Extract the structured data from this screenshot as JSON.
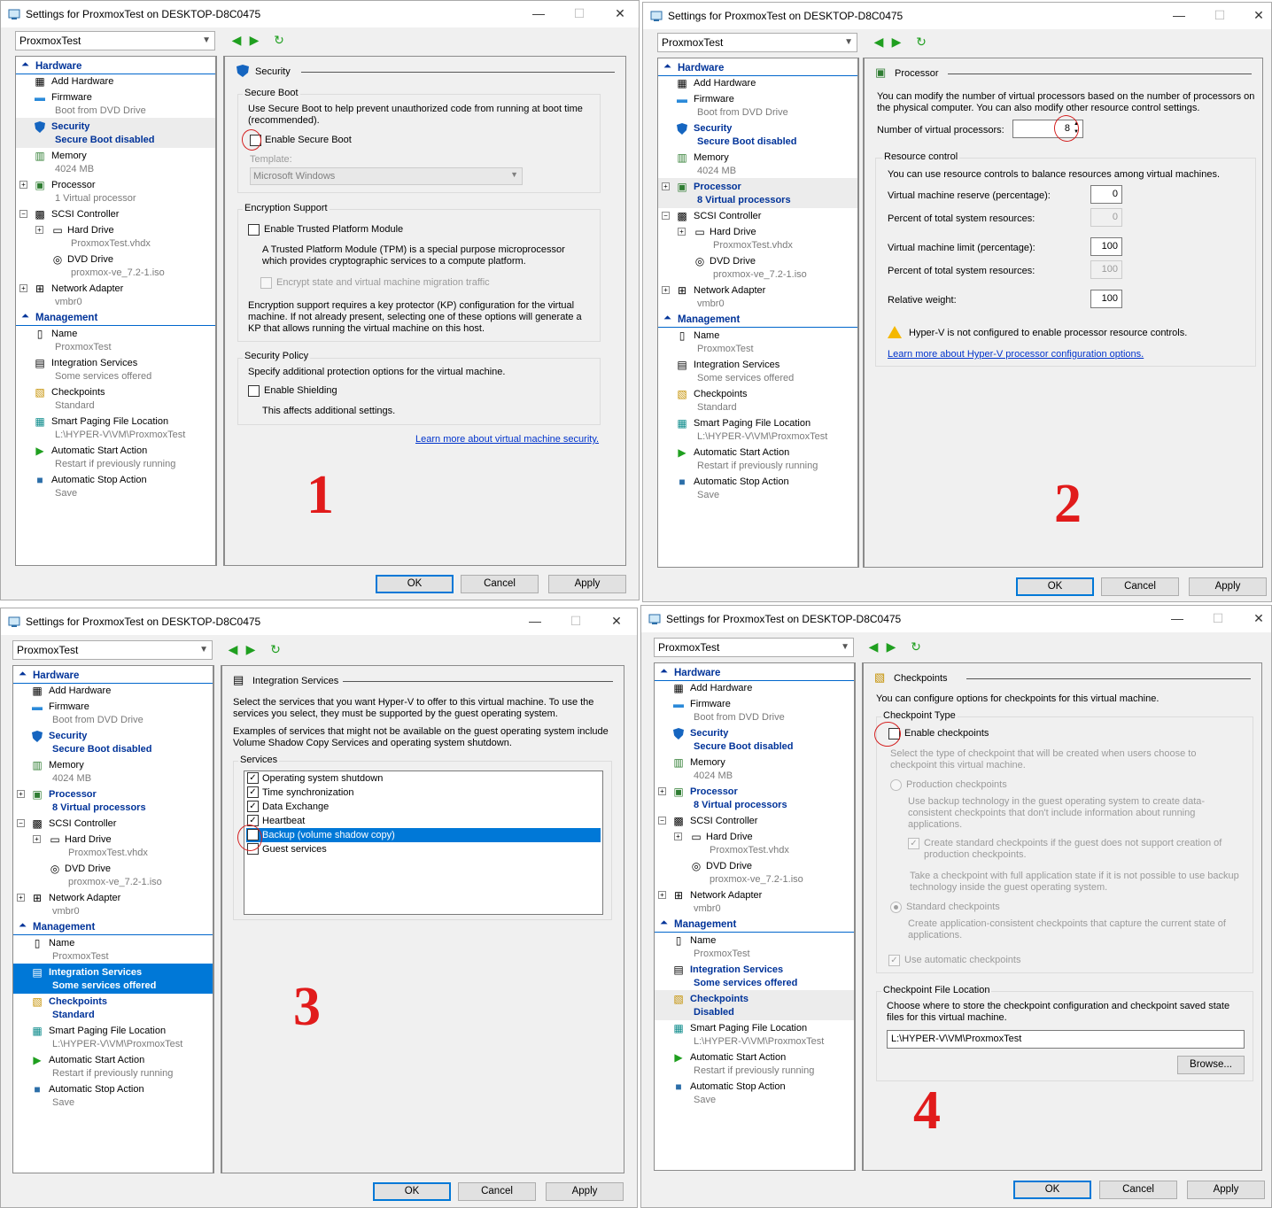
{
  "window_title": "Settings for ProxmoxTest on DESKTOP-D8C0475",
  "window_buttons": {
    "minimize": "—",
    "maximize": "☐",
    "close": "✕"
  },
  "vm_select": "ProxmoxTest",
  "nav": {
    "back": "◀",
    "forward": "▶",
    "refresh": "↻"
  },
  "tree": {
    "hardware": "Hardware",
    "add_hardware": "Add Hardware",
    "firmware": "Firmware",
    "firmware_sub": "Boot from DVD Drive",
    "security": "Security",
    "security_sub": "Secure Boot disabled",
    "memory": "Memory",
    "memory_sub": "4024 MB",
    "processor": "Processor",
    "processor_sub_1": "1 Virtual processor",
    "processor_sub_8": "8 Virtual processors",
    "scsi": "SCSI Controller",
    "hard_drive": "Hard Drive",
    "hard_drive_sub": "ProxmoxTest.vhdx",
    "dvd_drive": "DVD Drive",
    "dvd_drive_sub": "proxmox-ve_7.2-1.iso",
    "network": "Network Adapter",
    "network_sub": "vmbr0",
    "management": "Management",
    "name": "Name",
    "name_sub": "ProxmoxTest",
    "integration": "Integration Services",
    "integration_sub": "Some services offered",
    "checkpoints": "Checkpoints",
    "checkpoints_sub_standard": "Standard",
    "checkpoints_sub_disabled": "Disabled",
    "smart_paging": "Smart Paging File Location",
    "smart_paging_sub": "L:\\HYPER-V\\VM\\ProxmoxTest",
    "auto_start": "Automatic Start Action",
    "auto_start_sub": "Restart if previously running",
    "auto_stop": "Automatic Stop Action",
    "auto_stop_sub": "Save"
  },
  "buttons": {
    "ok": "OK",
    "cancel": "Cancel",
    "apply": "Apply"
  },
  "step_labels": [
    "1",
    "2",
    "3",
    "4"
  ],
  "security_page": {
    "title": "Security",
    "secure_boot_group": "Secure Boot",
    "secure_boot_desc": "Use Secure Boot to help prevent unauthorized code from running at boot time (recommended).",
    "enable_secure_boot": "Enable Secure Boot",
    "template_label": "Template:",
    "template_value": "Microsoft Windows",
    "encryption_group": "Encryption Support",
    "enable_tpm": "Enable Trusted Platform Module",
    "tpm_desc": "A Trusted Platform Module (TPM) is a special purpose microprocessor which provides cryptographic services to a compute platform.",
    "encrypt_state": "Encrypt state and virtual machine migration traffic",
    "kp_desc": "Encryption support requires a key protector (KP) configuration for the virtual machine. If not already present, selecting one of these options will generate a KP that allows running the virtual machine on this host.",
    "policy_group": "Security Policy",
    "policy_desc": "Specify additional protection options for the virtual machine.",
    "enable_shielding": "Enable Shielding",
    "shielding_desc": "This affects additional settings.",
    "learn_more": "Learn more about virtual machine security."
  },
  "processor_page": {
    "title": "Processor",
    "desc": "You can modify the number of virtual processors based on the number of processors on the physical computer. You can also modify other resource control settings.",
    "num_label": "Number of virtual processors:",
    "num_value": "8",
    "rc_group": "Resource control",
    "rc_desc": "You can use resource controls to balance resources among virtual machines.",
    "reserve_label": "Virtual machine reserve (percentage):",
    "reserve_value": "0",
    "pct1_label": "Percent of total system resources:",
    "pct1_value": "0",
    "limit_label": "Virtual machine limit (percentage):",
    "limit_value": "100",
    "pct2_label": "Percent of total system resources:",
    "pct2_value": "100",
    "weight_label": "Relative weight:",
    "weight_value": "100",
    "warning": "Hyper-V is not configured to enable processor resource controls.",
    "learn_more": "Learn more about Hyper-V processor configuration options."
  },
  "integration_page": {
    "title": "Integration Services",
    "desc1": "Select the services that you want Hyper-V to offer to this virtual machine. To use the services you select, they must be supported by the guest operating system.",
    "desc2": "Examples of services that might not be available on the guest operating system include Volume Shadow Copy Services and operating system shutdown.",
    "services_group": "Services",
    "services": [
      {
        "label": "Operating system shutdown",
        "checked": true
      },
      {
        "label": "Time synchronization",
        "checked": true
      },
      {
        "label": "Data Exchange",
        "checked": true
      },
      {
        "label": "Heartbeat",
        "checked": true
      },
      {
        "label": "Backup (volume shadow copy)",
        "checked": false
      },
      {
        "label": "Guest services",
        "checked": false
      }
    ]
  },
  "checkpoints_page": {
    "title": "Checkpoints",
    "desc": "You can configure options for checkpoints for this virtual machine.",
    "type_group": "Checkpoint Type",
    "enable": "Enable checkpoints",
    "type_desc": "Select the type of checkpoint that will be created when users choose to checkpoint this virtual machine.",
    "production": "Production checkpoints",
    "production_desc": "Use backup technology in the guest operating system to create data-consistent checkpoints that don't include information about running applications.",
    "create_standard": "Create standard checkpoints if the guest does not support creation of production checkpoints.",
    "full_app_desc": "Take a checkpoint with full application state if it is not possible to use backup technology inside the guest operating system.",
    "standard": "Standard checkpoints",
    "standard_desc": "Create application-consistent checkpoints that capture the current state of applications.",
    "use_auto": "Use automatic checkpoints",
    "location_group": "Checkpoint File Location",
    "location_desc": "Choose where to store the checkpoint configuration and checkpoint saved state files for this virtual machine.",
    "location_value": "L:\\HYPER-V\\VM\\ProxmoxTest",
    "browse": "Browse..."
  },
  "colors": {
    "accent": "#0078d7",
    "tree_header": "#003399",
    "annotation": "#e11b1b"
  }
}
